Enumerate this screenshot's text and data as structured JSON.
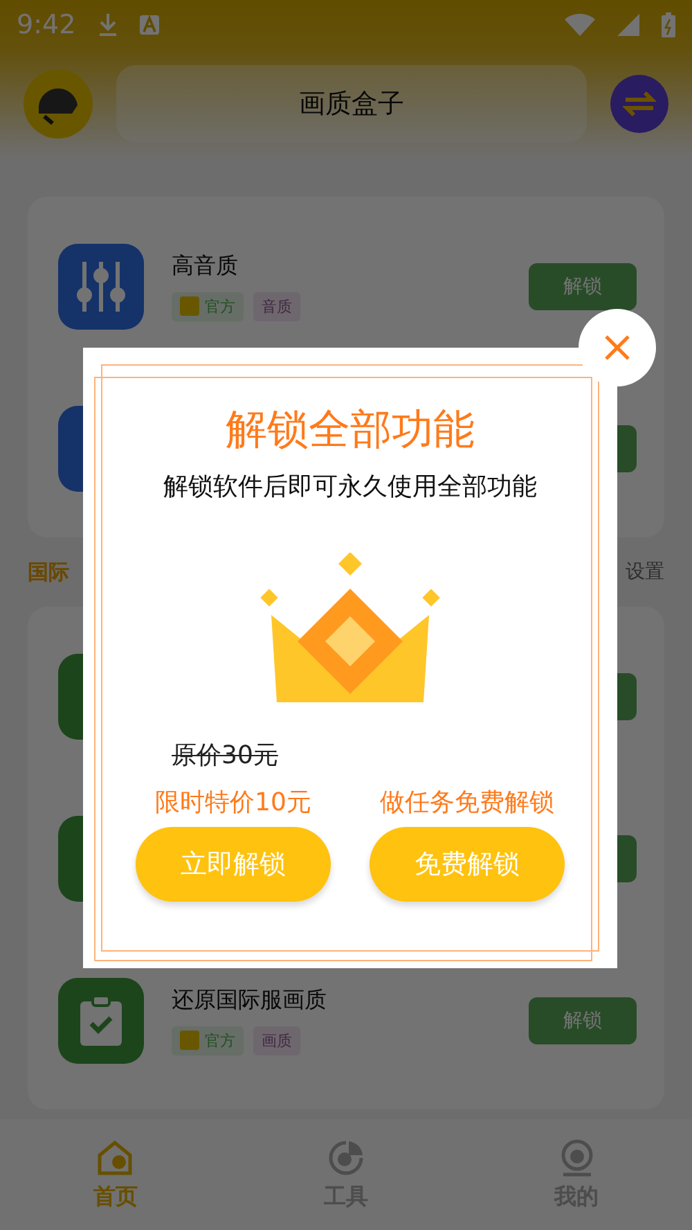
{
  "status_bar": {
    "time": "9:42"
  },
  "header": {
    "title": "画质盒子"
  },
  "groups": [
    {
      "features": [
        {
          "kind": "sliders",
          "title": "高音质",
          "tags": [
            {
              "label": "官方",
              "kind": "official"
            },
            {
              "label": "音质",
              "kind": "category"
            }
          ],
          "button": "解锁"
        },
        {
          "kind": "covered-blue"
        }
      ]
    },
    {
      "section": {
        "title": "国际",
        "action": "设置"
      },
      "features": [
        {
          "kind": "covered-green"
        },
        {
          "kind": "covered-green"
        },
        {
          "kind": "clipboard",
          "title": "还原国际服画质",
          "tags": [
            {
              "label": "官方",
              "kind": "official"
            },
            {
              "label": "画质",
              "kind": "category"
            }
          ],
          "button": "解锁"
        }
      ]
    }
  ],
  "nav": [
    {
      "label": "首页",
      "selected": true
    },
    {
      "label": "工具",
      "selected": false
    },
    {
      "label": "我的",
      "selected": false
    }
  ],
  "modal": {
    "title": "解锁全部功能",
    "subtitle": "解锁软件后即可永久使用全部功能",
    "original_price": "原价30元",
    "offers": [
      {
        "caption": "限时特价10元",
        "button": "立即解锁"
      },
      {
        "caption": "做任务免费解锁",
        "button": "免费解锁"
      }
    ]
  }
}
